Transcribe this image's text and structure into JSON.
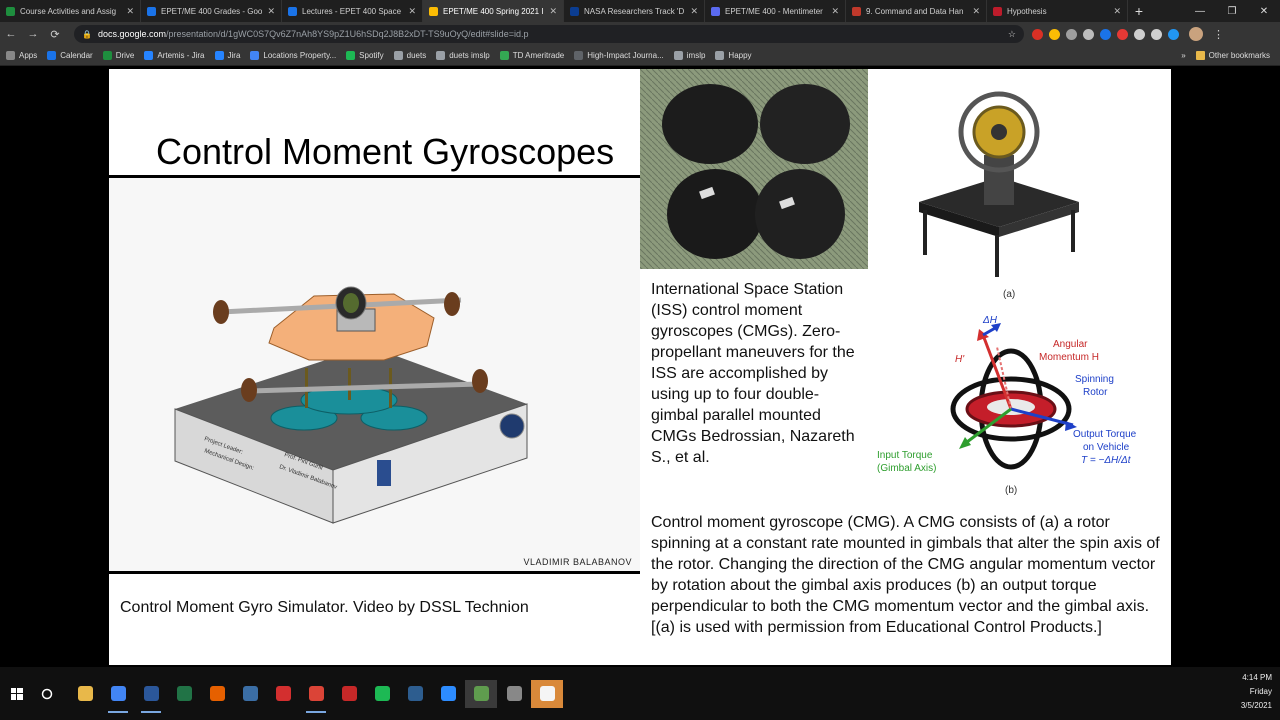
{
  "browser": {
    "tabs": [
      {
        "title": "Course Activities and Assig",
        "color": "#1e8e3e"
      },
      {
        "title": "EPET/ME 400 Grades - Goo",
        "color": "#1a73e8"
      },
      {
        "title": "Lectures - EPET 400 Space",
        "color": "#1a73e8"
      },
      {
        "title": "EPET/ME 400 Spring 2021 I",
        "color": "#fbbc04",
        "active": true
      },
      {
        "title": "NASA Researchers Track 'D",
        "color": "#0b3d91"
      },
      {
        "title": "EPET/ME 400 - Mentimeter",
        "color": "#5a6af0"
      },
      {
        "title": "9. Command and Data Han",
        "color": "#c0392b"
      },
      {
        "title": "Hypothesis",
        "color": "#bd1c2b"
      }
    ],
    "new_tab": "+",
    "url_host": "docs.google.com",
    "url_path": "/presentation/d/1gWC0S7Qv6Z7nAh8YS9pZ1U6hSDq2J8B2xDT-TS9uOyQ/edit#slide=id.p",
    "bookmarks": [
      "Apps",
      "Calendar",
      "Drive",
      "Artemis - Jira",
      "Jira",
      "Locations Property...",
      "Spotify",
      "duets",
      "duets imslp",
      "TD Ameritrade",
      "High-Impact Journa...",
      "imslp",
      "Happy"
    ],
    "bookmarks_more": "»",
    "other_bookmarks": "Other bookmarks"
  },
  "slide": {
    "title": "Control Moment Gyroscopes",
    "sim_credit": "VLADIMIR  BALABANOV",
    "sim_caption": "Control Moment Gyro Simulator. Video by DSSL Technion",
    "sim_base_text_1": "Project Leader:",
    "sim_base_text_2": "Mechanical Design:",
    "sim_base_text_3": "Prof. Pini Gurfil",
    "sim_base_text_4": "Dr. Vladimir Balabanov",
    "iss_caption": "International Space Station (ISS) control moment gyroscopes (CMGs). Zero-propellant maneuvers for the ISS are accomplished by using up to four double-gimbal parallel mounted CMGs Bedrossian, Nazareth S., et al.",
    "label_a": "(a)",
    "label_b": "(b)",
    "diagram_dh": "ΔH",
    "diagram_hprime": "H'",
    "diagram_ang1": "Angular",
    "diagram_ang2": "Momentum H",
    "diagram_spin1": "Spinning",
    "diagram_spin2": "Rotor",
    "diagram_out1": "Output Torque",
    "diagram_out2": "on Vehicle",
    "diagram_out3": "T = −ΔH/Δt",
    "diagram_in1": "Input Torque",
    "diagram_in2": "(Gimbal Axis)",
    "cmg_caption": "Control moment gyroscope (CMG). A CMG consists of (a) a rotor spinning at a constant rate mounted in gimbals that alter the spin axis of the rotor. Changing the direction of the CMG angular momentum vector by rotation about the gimbal axis produces (b) an output torque perpendicular to both the CMG momentum vector and the gimbal axis. [(a) is used with permission from Educational Control Products.]"
  },
  "taskbar": {
    "apps": [
      {
        "name": "file-explorer",
        "color": "#e8b84a"
      },
      {
        "name": "chrome",
        "color": "#4285f4",
        "running": true
      },
      {
        "name": "word",
        "color": "#2b579a",
        "running": true
      },
      {
        "name": "excel",
        "color": "#217346"
      },
      {
        "name": "firefox",
        "color": "#e66000"
      },
      {
        "name": "app-blue",
        "color": "#3b6ea5"
      },
      {
        "name": "acrobat",
        "color": "#d32f2f"
      },
      {
        "name": "chrome-2",
        "color": "#db4437",
        "running": true
      },
      {
        "name": "app-red",
        "color": "#c62828"
      },
      {
        "name": "spotify",
        "color": "#1db954"
      },
      {
        "name": "app-dark",
        "color": "#2d5d8f"
      },
      {
        "name": "zoom",
        "color": "#2d8cff"
      },
      {
        "name": "chrome-3",
        "color": "#5f9c4e",
        "active": true
      },
      {
        "name": "settings",
        "color": "#888"
      },
      {
        "name": "app-orange",
        "color": "#f5f5f5",
        "highlight": true
      }
    ],
    "time": "4:14 PM",
    "day": "Friday",
    "date": "3/5/2021"
  }
}
